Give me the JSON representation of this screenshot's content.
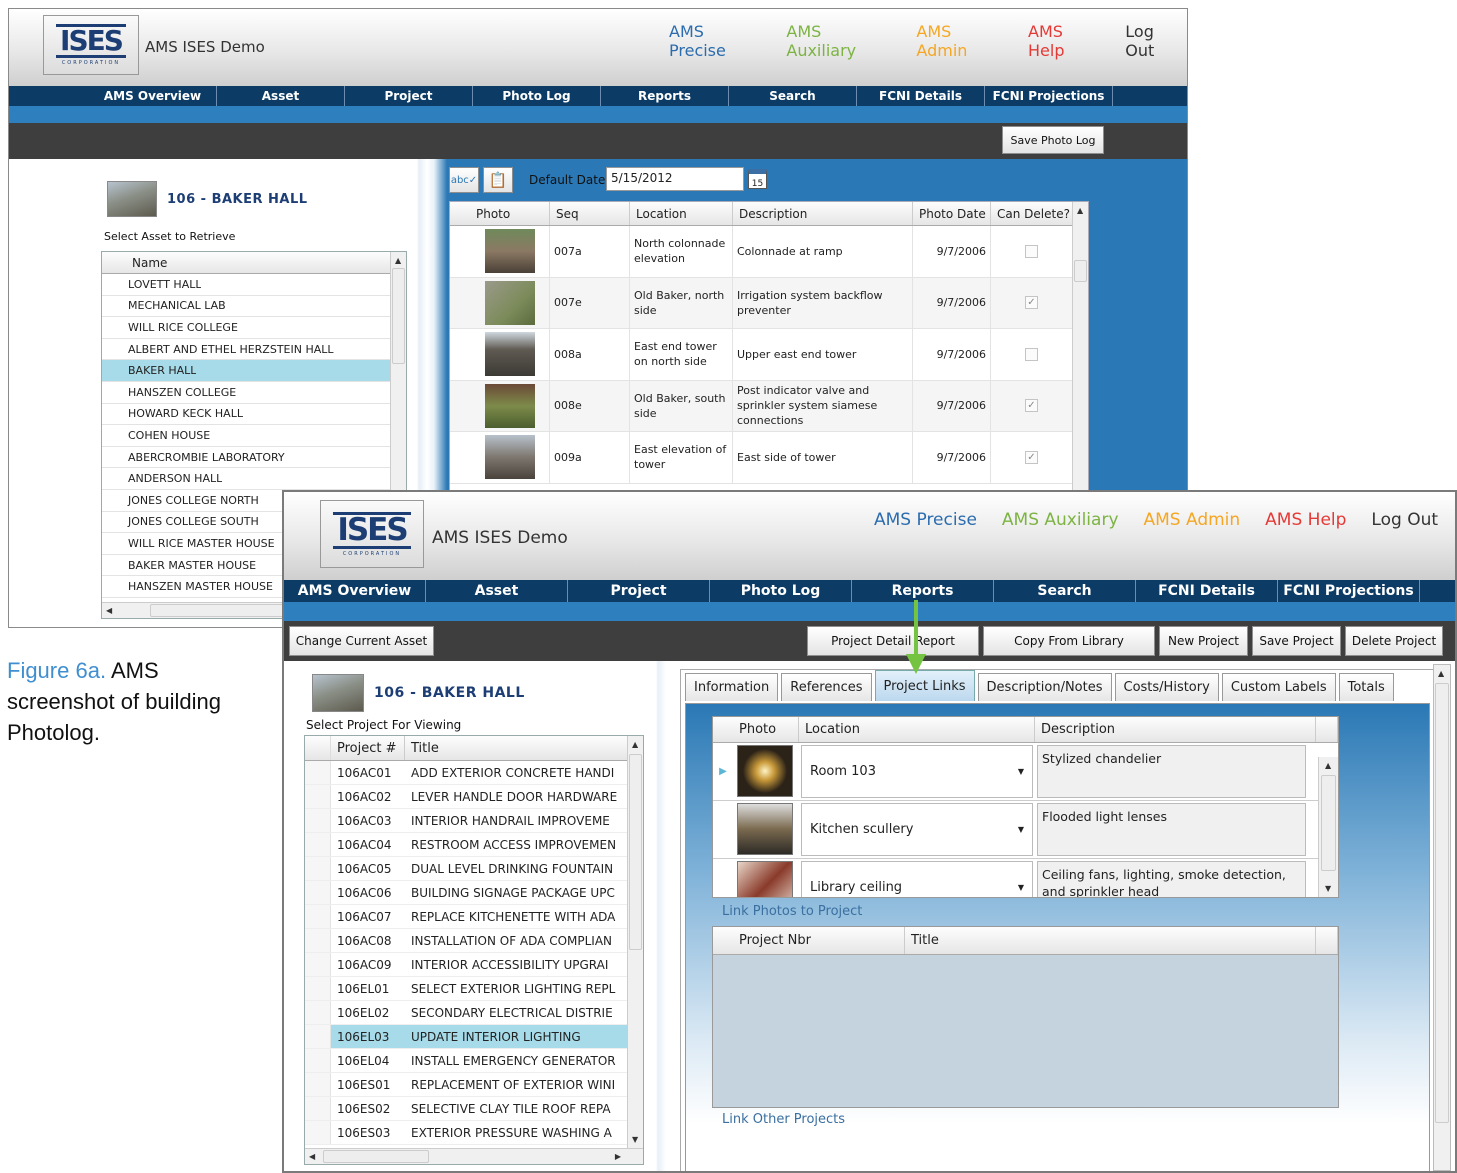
{
  "header": {
    "app_name": "AMS ISES Demo",
    "logo_text": "ISES",
    "logo_sub": "CORPORATION",
    "links": [
      {
        "label": "AMS Precise",
        "color": "#2b6cae"
      },
      {
        "label": "AMS Auxiliary",
        "color": "#7cb342"
      },
      {
        "label": "AMS Admin",
        "color": "#f5a623"
      },
      {
        "label": "AMS Help",
        "color": "#e53935"
      },
      {
        "label": "Log Out",
        "color": "#333333"
      }
    ]
  },
  "nav": [
    "AMS Overview",
    "Asset",
    "Project",
    "Photo Log",
    "Reports",
    "Search",
    "FCNI Details",
    "FCNI Projections"
  ],
  "photolog": {
    "save_button": "Save Photo Log",
    "building": "106 - BAKER HALL",
    "select_label": "Select Asset to Retrieve",
    "assets_header": "Name",
    "assets": [
      "LOVETT HALL",
      "MECHANICAL LAB",
      "WILL RICE COLLEGE",
      "ALBERT AND ETHEL HERZSTEIN HALL",
      "BAKER HALL",
      "HANSZEN COLLEGE",
      "HOWARD KECK HALL",
      "COHEN HOUSE",
      "ABERCROMBIE LABORATORY",
      "ANDERSON HALL",
      "JONES COLLEGE NORTH",
      "JONES COLLEGE SOUTH",
      "WILL RICE MASTER HOUSE",
      "BAKER MASTER HOUSE",
      "HANSZEN MASTER HOUSE"
    ],
    "selected_asset": "BAKER HALL",
    "default_date_label": "Default Date",
    "default_date": "5/15/2012",
    "calendar_day": "15",
    "columns": [
      "Photo",
      "Seq",
      "Location",
      "Description",
      "Photo Date",
      "Can Delete?"
    ],
    "rows": [
      {
        "seq": "007a",
        "location": "North colonnade elevation",
        "description": "Colonnade at ramp",
        "date": "9/7/2006",
        "can_delete": false
      },
      {
        "seq": "007e",
        "location": "Old Baker, north side",
        "description": "Irrigation system backflow preventer",
        "date": "9/7/2006",
        "can_delete": true
      },
      {
        "seq": "008a",
        "location": "East end tower on north side",
        "description": "Upper east end tower",
        "date": "9/7/2006",
        "can_delete": false
      },
      {
        "seq": "008e",
        "location": "Old Baker, south side",
        "description": "Post indicator valve and sprinkler system siamese connections",
        "date": "9/7/2006",
        "can_delete": true
      },
      {
        "seq": "009a",
        "location": "East elevation of tower",
        "description": "East side of tower",
        "date": "9/7/2006",
        "can_delete": true
      }
    ]
  },
  "caption": {
    "fig": "Figure 6a.",
    "text": "AMS screenshot of building Photolog."
  },
  "project": {
    "buttons": {
      "change_asset": "Change Current Asset",
      "detail_report": "Project Detail Report",
      "copy_library": "Copy From Library",
      "new": "New Project",
      "save": "Save Project",
      "delete": "Delete Project"
    },
    "building": "106 - BAKER HALL",
    "select_label": "Select Project For Viewing",
    "columns": [
      "Project #",
      "Title"
    ],
    "projects": [
      {
        "num": "106AC01",
        "title": "ADD EXTERIOR CONCRETE HANDI"
      },
      {
        "num": "106AC02",
        "title": "LEVER HANDLE DOOR HARDWARE"
      },
      {
        "num": "106AC03",
        "title": "INTERIOR HANDRAIL IMPROVEME"
      },
      {
        "num": "106AC04",
        "title": "RESTROOM ACCESS IMPROVEMEN"
      },
      {
        "num": "106AC05",
        "title": "DUAL LEVEL DRINKING FOUNTAIN"
      },
      {
        "num": "106AC06",
        "title": "BUILDING SIGNAGE PACKAGE UPC"
      },
      {
        "num": "106AC07",
        "title": "REPLACE KITCHENETTE WITH ADA"
      },
      {
        "num": "106AC08",
        "title": "INSTALLATION OF ADA COMPLIAN"
      },
      {
        "num": "106AC09",
        "title": "INTERIOR ACCESSIBILITY UPGRAI"
      },
      {
        "num": "106EL01",
        "title": "SELECT EXTERIOR LIGHTING REPL"
      },
      {
        "num": "106EL02",
        "title": "SECONDARY ELECTRICAL DISTRIE"
      },
      {
        "num": "106EL03",
        "title": "UPDATE INTERIOR LIGHTING"
      },
      {
        "num": "106EL04",
        "title": "INSTALL EMERGENCY GENERATOR"
      },
      {
        "num": "106ES01",
        "title": "REPLACEMENT OF EXTERIOR WINI"
      },
      {
        "num": "106ES02",
        "title": "SELECTIVE CLAY TILE ROOF REPA"
      },
      {
        "num": "106ES03",
        "title": "EXTERIOR PRESSURE WASHING A"
      }
    ],
    "selected_project": "106EL03",
    "tabs": [
      "Information",
      "References",
      "Project Links",
      "Description/Notes",
      "Costs/History",
      "Custom Labels",
      "Totals"
    ],
    "active_tab": "Project Links",
    "links_columns": [
      "Photo",
      "Location",
      "Description"
    ],
    "links_rows": [
      {
        "location": "Room 103",
        "description": "Stylized chandelier"
      },
      {
        "location": "Kitchen scullery",
        "description": "Flooded light lenses"
      },
      {
        "location": "Library ceiling",
        "description": "Ceiling fans, lighting, smoke detection, and sprinkler head"
      }
    ],
    "link_photos": "Link Photos to Project",
    "other_columns": [
      "Project Nbr",
      "Title"
    ],
    "link_other": "Link Other Projects"
  }
}
